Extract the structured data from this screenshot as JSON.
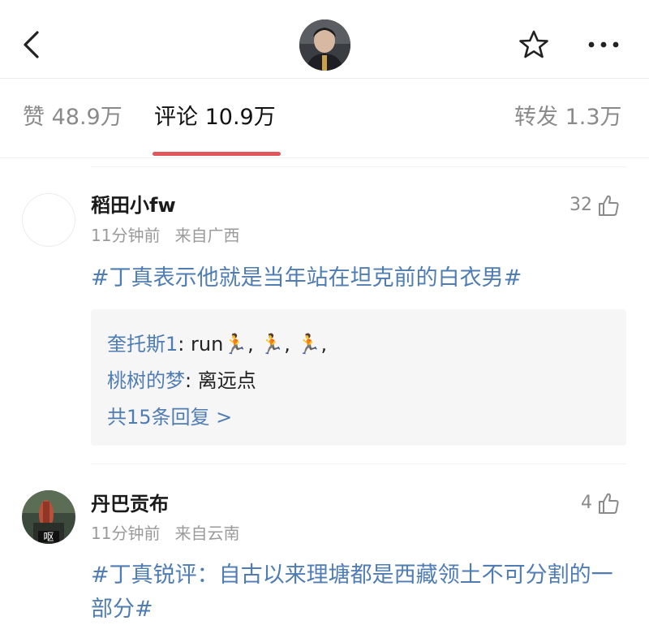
{
  "header": {
    "back_icon": "chevron-left-icon",
    "star_icon": "star-outline-icon",
    "more_icon": "more-horizontal-icon"
  },
  "tabs": [
    {
      "label": "赞 48.9万",
      "active": false
    },
    {
      "label": "评论 10.9万",
      "active": true
    },
    {
      "label": "转发 1.3万",
      "active": false
    }
  ],
  "accent_color": "#e2555d",
  "link_color": "#4f7db3",
  "comments": [
    {
      "username": "稻田小fw",
      "time": "11分钟前",
      "location": "来自广西",
      "likes": "32",
      "text": "#丁真表示他就是当年站在坦克前的白衣男#",
      "replies": [
        {
          "user": "奎托斯1",
          "text": ": run🏃, 🏃, 🏃,"
        },
        {
          "user": "桃树的梦",
          "text": ": 离远点"
        }
      ],
      "more_replies": "共15条回复 >"
    },
    {
      "username": "丹巴贡布",
      "time": "11分钟前",
      "location": "来自云南",
      "likes": "4",
      "avatar_badge": "呕",
      "text": "#丁真锐评：自古以来理塘都是西藏领土不可分割的一部分#"
    }
  ]
}
